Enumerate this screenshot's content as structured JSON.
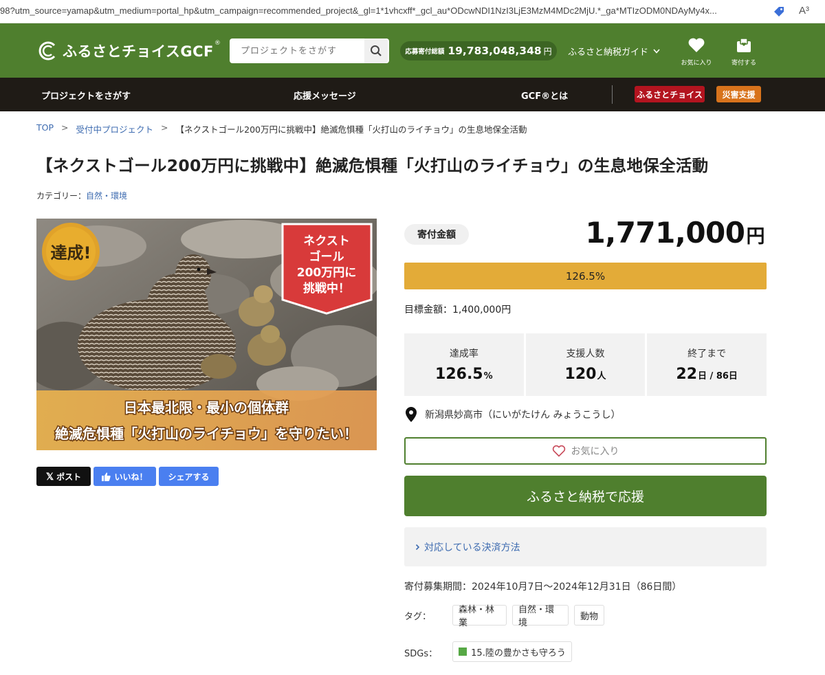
{
  "browser": {
    "url": "98?utm_source=yamap&utm_medium=portal_hp&utm_campaign=recommended_project&_gl=1*1vhcxff*_gcl_au*ODcwNDI1NzI3LjE3MzM4MDc2MjU.*_ga*MTIzODM0NDAyMy4x...",
    "read_aloud": "A³"
  },
  "header": {
    "logo_text": "ふるさとチョイスGCF",
    "logo_registered": "®",
    "search_placeholder": "プロジェクトをさがす",
    "total_label": "応募寄付総額",
    "total_value": "19,783,048,348",
    "total_unit": "円",
    "guide_label": "ふるさと納税ガイド",
    "favorites_label": "お気に入り",
    "donate_label": "寄付する"
  },
  "nav": {
    "find": "プロジェクトをさがす",
    "messages": "応援メッセージ",
    "about": "GCF®とは",
    "badge_choice": "ふるさとチョイス",
    "badge_disaster": "災害支援",
    "colors": {
      "choice": "#b3141f",
      "disaster": "#d8731c"
    }
  },
  "breadcrumb": {
    "top": "TOP",
    "accepting": "受付中プロジェクト",
    "current": "【ネクストゴール200万円に挑戦中】絶滅危惧種「火打山のライチョウ」の生息地保全活動",
    "sep": ">"
  },
  "page": {
    "title": "【ネクストゴール200万円に挑戦中】絶滅危惧種「火打山のライチョウ」の生息地保全活動",
    "category_label": "カテゴリー：",
    "category_value": "自然・環境"
  },
  "hero": {
    "badge_achieved": "達成!",
    "next_goal_lines": [
      "ネクスト",
      "ゴール",
      "200万円に",
      "挑戦中！"
    ],
    "caption_lines": [
      "日本最北限・最小の個体群",
      "絶滅危惧種「火打山のライチョウ」を守りたい！"
    ]
  },
  "share": {
    "x_post": "ポスト",
    "like": "いいね！",
    "share": "シェアする"
  },
  "funding": {
    "amount_label": "寄付金額",
    "amount_value": "1,771,000",
    "amount_unit": "円",
    "progress_text": "126.5%",
    "progress_fraction": 1.0,
    "goal_text": "目標金額：1,400,000円",
    "stats": [
      {
        "label": "達成率",
        "value": "126.5",
        "unit": "%"
      },
      {
        "label": "支援人数",
        "value": "120",
        "unit": "人"
      },
      {
        "label": "終了まで",
        "value": "22",
        "unit": "日 / 86日"
      }
    ],
    "location": "新潟県妙高市（にいがたけん みょうこうし）",
    "favorite_label": "お気に入り",
    "support_label": "ふるさと納税で応援",
    "payment_label": "対応している決済方法",
    "period": "寄付募集期間：2024年10月7日〜2024年12月31日（86日間）",
    "tags_label": "タグ：",
    "tags": [
      "森林・林業",
      "自然・環境",
      "動物"
    ],
    "sdgs_label": "SDGs：",
    "sdgs": [
      "15.陸の豊かさも守ろう"
    ]
  },
  "colors": {
    "brand_green": "#4f7f2e",
    "progress": "#e3ab38",
    "link": "#3d6bb0"
  }
}
